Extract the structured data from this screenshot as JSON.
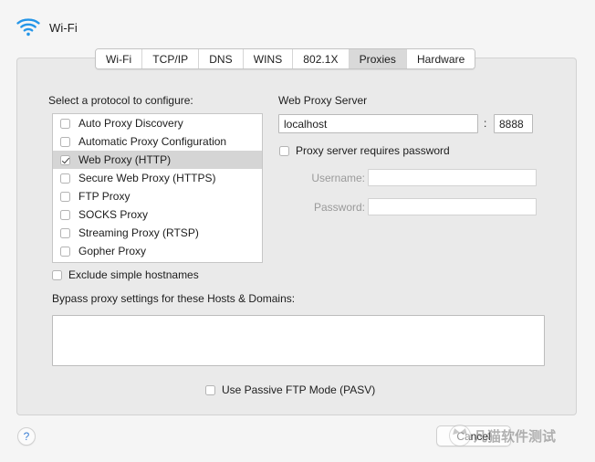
{
  "window": {
    "header_title": "Wi-Fi",
    "wifi_icon": "wifi-icon",
    "accent_color": "#3b7fd4",
    "panel_bg": "#eaeaea",
    "selected_row_bg": "#d5d5d5"
  },
  "tabs": [
    {
      "label": "Wi-Fi",
      "selected": false
    },
    {
      "label": "TCP/IP",
      "selected": false
    },
    {
      "label": "DNS",
      "selected": false
    },
    {
      "label": "WINS",
      "selected": false
    },
    {
      "label": "802.1X",
      "selected": false
    },
    {
      "label": "Proxies",
      "selected": true
    },
    {
      "label": "Hardware",
      "selected": false
    }
  ],
  "protocols": {
    "heading": "Select a protocol to configure:",
    "items": [
      {
        "label": "Auto Proxy Discovery",
        "checked": false,
        "selected": false
      },
      {
        "label": "Automatic Proxy Configuration",
        "checked": false,
        "selected": false
      },
      {
        "label": "Web Proxy (HTTP)",
        "checked": true,
        "selected": true
      },
      {
        "label": "Secure Web Proxy (HTTPS)",
        "checked": false,
        "selected": false
      },
      {
        "label": "FTP Proxy",
        "checked": false,
        "selected": false
      },
      {
        "label": "SOCKS Proxy",
        "checked": false,
        "selected": false
      },
      {
        "label": "Streaming Proxy (RTSP)",
        "checked": false,
        "selected": false
      },
      {
        "label": "Gopher Proxy",
        "checked": false,
        "selected": false
      }
    ]
  },
  "proxy_server": {
    "heading": "Web Proxy Server",
    "host_value": "localhost",
    "host_placeholder": "",
    "separator": ":",
    "port_value": "8888",
    "port_placeholder": "",
    "requires_password_label": "Proxy server requires password",
    "requires_password_checked": false,
    "username_label": "Username:",
    "username_value": "",
    "password_label": "Password:",
    "password_value": ""
  },
  "bypass": {
    "exclude_simple_hostnames_label": "Exclude simple hostnames",
    "exclude_simple_hostnames_checked": false,
    "heading": "Bypass proxy settings for these Hosts & Domains:",
    "value": "",
    "passive_ftp_label": "Use Passive FTP Mode (PASV)",
    "passive_ftp_checked": false
  },
  "footer": {
    "help_glyph": "?",
    "cancel_label": "Cancel"
  },
  "watermark": {
    "text": "凡猫软件测试",
    "logo": "cat-logo-icon"
  }
}
